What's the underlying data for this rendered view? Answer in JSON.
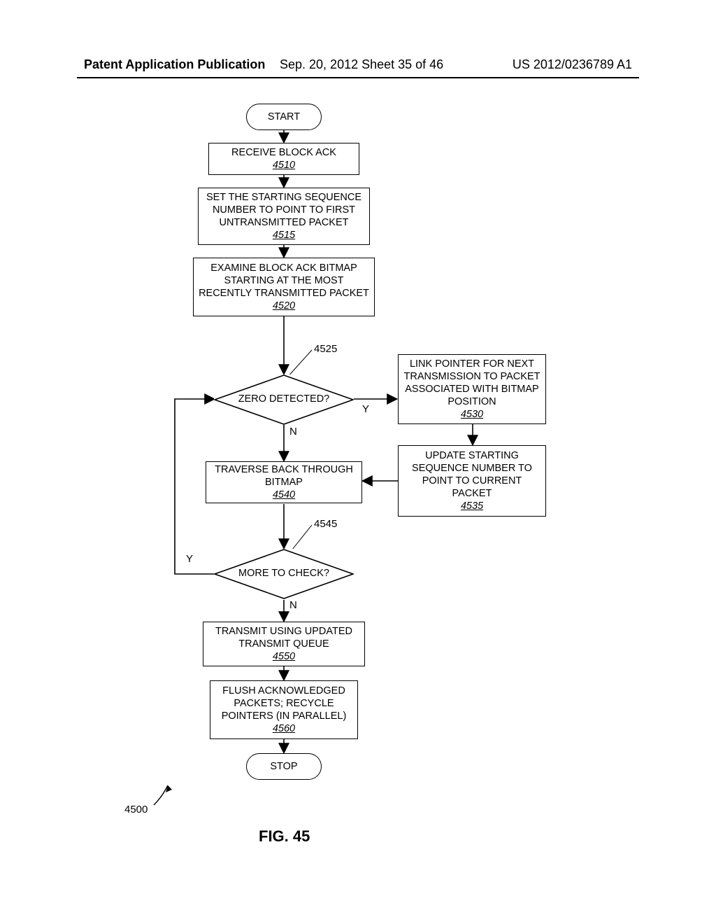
{
  "header": {
    "left": "Patent Application Publication",
    "mid": "Sep. 20, 2012  Sheet 35 of 46",
    "right": "US 2012/0236789 A1"
  },
  "nodes": {
    "start": "START",
    "stop": "STOP",
    "n4510": {
      "text": "RECEIVE BLOCK ACK",
      "ref": "4510"
    },
    "n4515": {
      "text": "SET THE STARTING SEQUENCE NUMBER TO POINT TO FIRST UNTRANSMITTED PACKET",
      "ref": "4515"
    },
    "n4520": {
      "text": "EXAMINE BLOCK ACK BITMAP STARTING AT THE MOST RECENTLY TRANSMITTED PACKET",
      "ref": "4520"
    },
    "d4525": {
      "text": "ZERO DETECTED?",
      "ref": "4525"
    },
    "n4530": {
      "text": "LINK POINTER FOR NEXT TRANSMISSION TO PACKET ASSOCIATED WITH BITMAP POSITION",
      "ref": "4530"
    },
    "n4535": {
      "text": "UPDATE STARTING SEQUENCE NUMBER TO POINT TO CURRENT PACKET",
      "ref": "4535"
    },
    "n4540": {
      "text": "TRAVERSE BACK THROUGH BITMAP",
      "ref": "4540"
    },
    "d4545": {
      "text": "MORE TO CHECK?",
      "ref": "4545"
    },
    "n4550": {
      "text": "TRANSMIT USING UPDATED TRANSMIT QUEUE",
      "ref": "4550"
    },
    "n4560": {
      "text": "FLUSH ACKNOWLEDGED PACKETS; RECYCLE POINTERS (IN PARALLEL)",
      "ref": "4560"
    }
  },
  "labels": {
    "y1": "Y",
    "n1": "N",
    "y2": "Y",
    "n2": "N",
    "figref": "4500",
    "caption": "FIG. 45"
  },
  "chart_data": {
    "type": "flowchart",
    "title": "FIG. 45",
    "reference_numeral": "4500",
    "nodes": [
      {
        "id": "start",
        "shape": "terminator",
        "label": "START"
      },
      {
        "id": "4510",
        "shape": "process",
        "label": "RECEIVE BLOCK ACK"
      },
      {
        "id": "4515",
        "shape": "process",
        "label": "SET THE STARTING SEQUENCE NUMBER TO POINT TO FIRST UNTRANSMITTED PACKET"
      },
      {
        "id": "4520",
        "shape": "process",
        "label": "EXAMINE BLOCK ACK BITMAP STARTING AT THE MOST RECENTLY TRANSMITTED PACKET"
      },
      {
        "id": "4525",
        "shape": "decision",
        "label": "ZERO DETECTED?"
      },
      {
        "id": "4530",
        "shape": "process",
        "label": "LINK POINTER FOR NEXT TRANSMISSION TO PACKET ASSOCIATED WITH BITMAP POSITION"
      },
      {
        "id": "4535",
        "shape": "process",
        "label": "UPDATE STARTING SEQUENCE NUMBER TO POINT TO CURRENT PACKET"
      },
      {
        "id": "4540",
        "shape": "process",
        "label": "TRAVERSE BACK THROUGH BITMAP"
      },
      {
        "id": "4545",
        "shape": "decision",
        "label": "MORE TO CHECK?"
      },
      {
        "id": "4550",
        "shape": "process",
        "label": "TRANSMIT USING UPDATED TRANSMIT QUEUE"
      },
      {
        "id": "4560",
        "shape": "process",
        "label": "FLUSH ACKNOWLEDGED PACKETS; RECYCLE POINTERS (IN PARALLEL)"
      },
      {
        "id": "stop",
        "shape": "terminator",
        "label": "STOP"
      }
    ],
    "edges": [
      {
        "from": "start",
        "to": "4510"
      },
      {
        "from": "4510",
        "to": "4515"
      },
      {
        "from": "4515",
        "to": "4520"
      },
      {
        "from": "4520",
        "to": "4525"
      },
      {
        "from": "4525",
        "to": "4530",
        "label": "Y"
      },
      {
        "from": "4525",
        "to": "4540",
        "label": "N"
      },
      {
        "from": "4530",
        "to": "4535"
      },
      {
        "from": "4535",
        "to": "4540"
      },
      {
        "from": "4540",
        "to": "4545"
      },
      {
        "from": "4545",
        "to": "4525",
        "label": "Y"
      },
      {
        "from": "4545",
        "to": "4550",
        "label": "N"
      },
      {
        "from": "4550",
        "to": "4560"
      },
      {
        "from": "4560",
        "to": "stop"
      }
    ]
  }
}
